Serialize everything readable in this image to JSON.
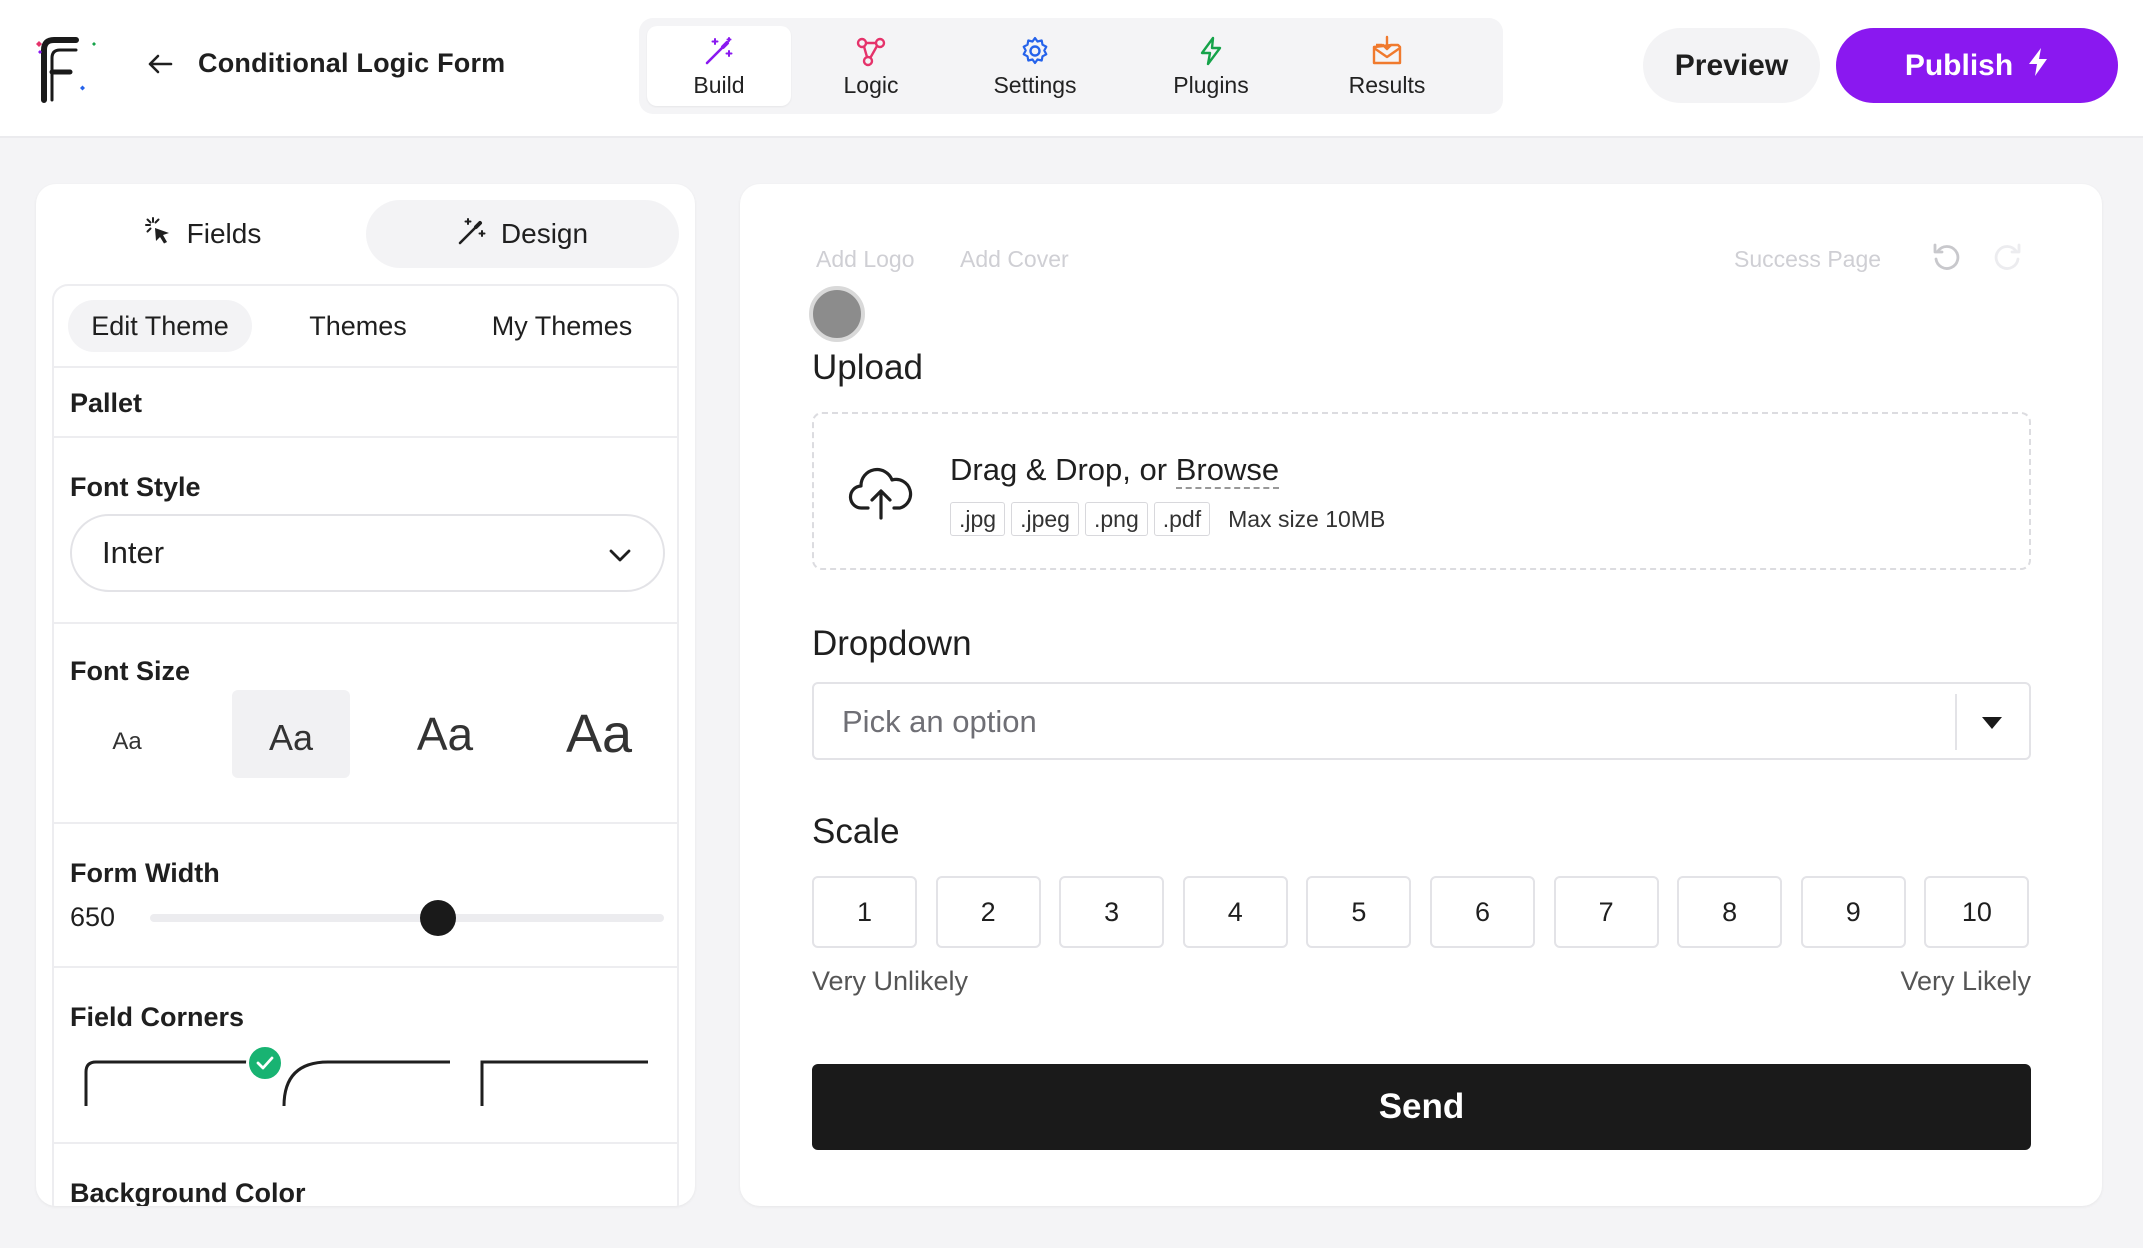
{
  "header": {
    "form_title": "Conditional Logic Form",
    "tabs": [
      {
        "label": "Build",
        "icon": "magic-wand-icon",
        "color": "#8a18f0"
      },
      {
        "label": "Logic",
        "icon": "nodes-icon",
        "color": "#e5336b"
      },
      {
        "label": "Settings",
        "icon": "gear-icon",
        "color": "#2563eb"
      },
      {
        "label": "Plugins",
        "icon": "lightning-icon",
        "color": "#16a34a"
      },
      {
        "label": "Results",
        "icon": "inbox-icon",
        "color": "#f07a2e"
      }
    ],
    "preview_label": "Preview",
    "publish_label": "Publish"
  },
  "sidebar": {
    "tabs": {
      "fields": "Fields",
      "design": "Design"
    },
    "sub_tabs": {
      "edit_theme": "Edit Theme",
      "themes": "Themes",
      "my_themes": "My Themes"
    },
    "pallet_label": "Pallet",
    "font_style_label": "Font Style",
    "font_style_value": "Inter",
    "font_size_label": "Font Size",
    "font_size_options": [
      "Aa",
      "Aa",
      "Aa",
      "Aa"
    ],
    "form_width_label": "Form Width",
    "form_width_value": "650",
    "form_width_fraction": 0.56,
    "field_corners_label": "Field Corners",
    "background_color_label": "Background Color"
  },
  "canvas": {
    "add_logo": "Add Logo",
    "add_cover": "Add Cover",
    "success_page": "Success Page",
    "upload": {
      "label": "Upload",
      "drag_drop": "Drag & Drop, or ",
      "browse": "Browse",
      "extensions": [
        ".jpg",
        ".jpeg",
        ".png",
        ".pdf"
      ],
      "max_size": "Max size 10MB"
    },
    "dropdown": {
      "label": "Dropdown",
      "placeholder": "Pick an option"
    },
    "scale": {
      "label": "Scale",
      "options": [
        "1",
        "2",
        "3",
        "4",
        "5",
        "6",
        "7",
        "8",
        "9",
        "10"
      ],
      "low_label": "Very Unlikely",
      "high_label": "Very Likely"
    },
    "send_label": "Send"
  },
  "colors": {
    "accent": "#8a18f0",
    "success": "#18b372",
    "send_bg": "#1a1a1a"
  }
}
